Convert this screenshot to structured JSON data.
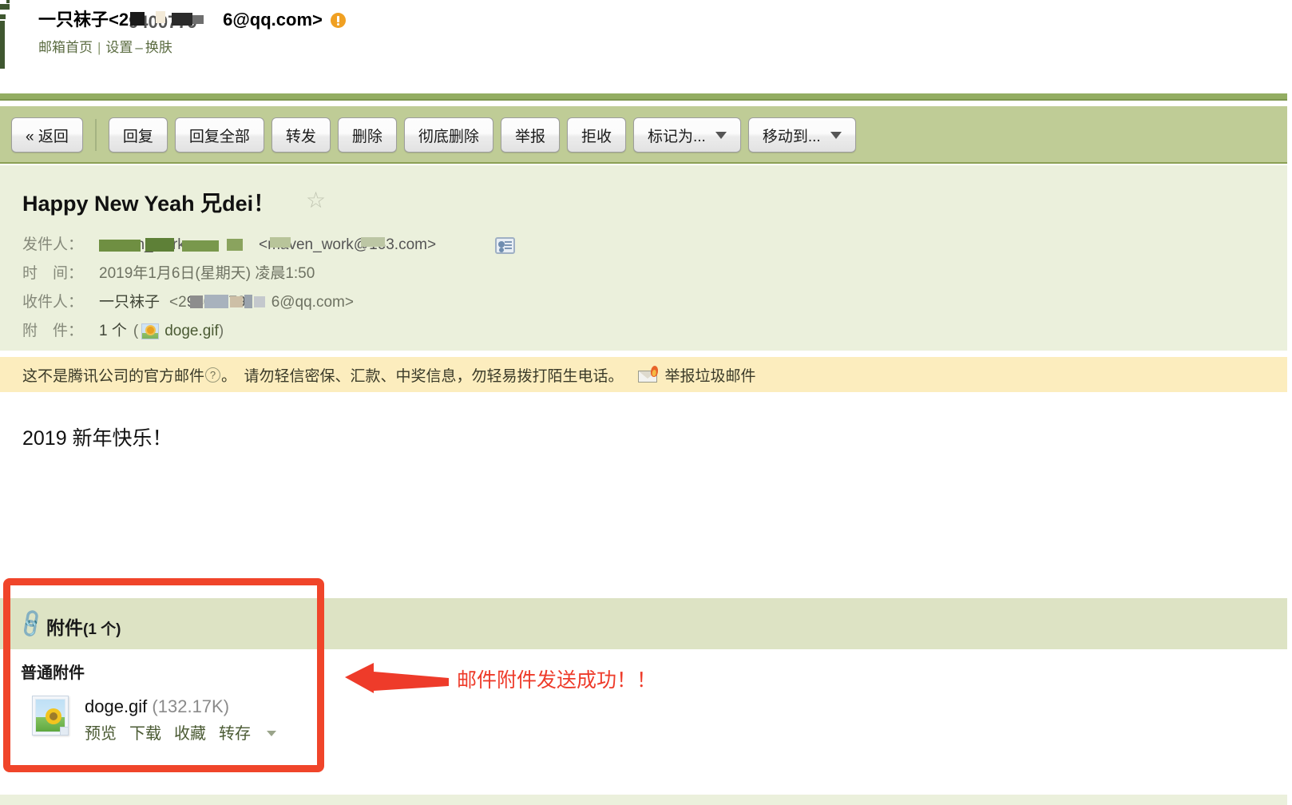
{
  "account": {
    "display_name": "一只袜子",
    "email_prefix": "<2",
    "email_redacted": "9400779",
    "email_suffix": "6@qq.com>",
    "warning_icon": "alert-exclamation-icon",
    "nav": {
      "home": "邮箱首页",
      "separator": "|",
      "settings": "设置",
      "dash": "–",
      "skin": "换肤"
    }
  },
  "toolbar": {
    "back": "« 返回",
    "reply": "回复",
    "reply_all": "回复全部",
    "forward": "转发",
    "delete": "删除",
    "delete_forever": "彻底删除",
    "report": "举报",
    "reject": "拒收",
    "mark_as": "标记为...",
    "move_to": "移动到..."
  },
  "mail": {
    "subject": "Happy New Yeah 兄dei！",
    "star_icon": "star-outline-icon",
    "labels": {
      "from": "发件人：",
      "date": "时　间：",
      "to": "收件人：",
      "attachment": "附　件："
    },
    "from": {
      "name_redacted": "maven_work",
      "address": "<maven_work@163.com>",
      "contact_icon": "contact-card-icon"
    },
    "date": "2019年1月6日(星期天) 凌晨1:50",
    "to": {
      "name": "一只袜子",
      "prefix": "<2",
      "redacted": "9400779",
      "suffix": "6@qq.com>"
    },
    "attachment_line": {
      "count": "1 个",
      "open_paren": "(",
      "thumb_icon": "image-thumbnail-icon",
      "filename": "doge.gif",
      "close_paren": ")"
    }
  },
  "warning": {
    "text_before_q": "这不是腾讯公司的官方邮件",
    "help_icon": "question-mark-icon",
    "text_after_q": "。　请勿轻信密保、汇款、中奖信息，勿轻易拨打陌生电话。",
    "spam_icon": "burning-envelope-icon",
    "spam_link": "举报垃圾邮件"
  },
  "body": {
    "content": "2019 新年快乐！"
  },
  "attachments_panel": {
    "clip_icon": "paperclip-icon",
    "header_title": "附件",
    "header_count": "(1 个)",
    "section_title": "普通附件",
    "items": [
      {
        "icon": "image-file-icon",
        "filename": "doge.gif",
        "size": "(132.17K)",
        "actions": {
          "preview": "预览",
          "download": "下载",
          "favorite": "收藏",
          "save_to": "转存",
          "caret_icon": "chevron-down-icon"
        }
      }
    ]
  },
  "annotation": {
    "box_label": "highlight-box",
    "arrow_icon": "left-arrow-icon",
    "text": "邮件附件发送成功！！",
    "color": "#ee3b2a"
  },
  "colors": {
    "toolbar_bg": "#bfcc96",
    "header_rule": "#93ad62",
    "mailhead_bg": "#ebf0dc",
    "warn_bg": "#fcedbe",
    "attach_head_bg": "#dde3c4",
    "annotation_red": "#f0452a",
    "link_green": "#5a6b40"
  }
}
